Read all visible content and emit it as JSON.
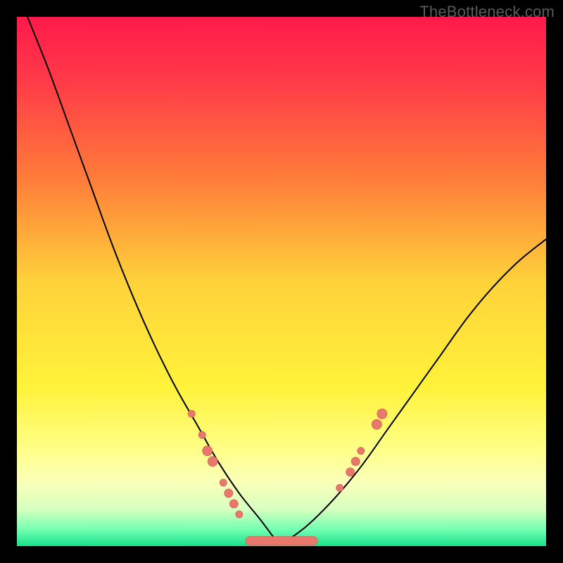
{
  "watermark": "TheBottleneck.com",
  "chart_data": {
    "type": "line",
    "title": "",
    "xlabel": "",
    "ylabel": "",
    "xlim": [
      0,
      100
    ],
    "ylim": [
      0,
      100
    ],
    "background_gradient_stops": [
      {
        "offset": 0.0,
        "color": "#ff1a4b"
      },
      {
        "offset": 0.12,
        "color": "#ff3a48"
      },
      {
        "offset": 0.3,
        "color": "#ff7a3a"
      },
      {
        "offset": 0.5,
        "color": "#ffd23a"
      },
      {
        "offset": 0.7,
        "color": "#fff23a"
      },
      {
        "offset": 0.82,
        "color": "#ffff8a"
      },
      {
        "offset": 0.88,
        "color": "#f9ffb8"
      },
      {
        "offset": 0.93,
        "color": "#d8ffc0"
      },
      {
        "offset": 0.97,
        "color": "#6fffb0"
      },
      {
        "offset": 1.0,
        "color": "#16e08a"
      }
    ],
    "series": [
      {
        "name": "left-curve",
        "x": [
          2,
          6,
          10,
          14,
          18,
          22,
          26,
          30,
          34,
          38,
          42,
          46,
          49
        ],
        "y": [
          100,
          90,
          79,
          68,
          57,
          47,
          38,
          30,
          23,
          16,
          10,
          5,
          1
        ]
      },
      {
        "name": "valley-floor",
        "x": [
          44,
          56
        ],
        "y": [
          1,
          1
        ]
      },
      {
        "name": "right-curve",
        "x": [
          51,
          55,
          60,
          65,
          70,
          75,
          80,
          85,
          90,
          95,
          100
        ],
        "y": [
          1,
          4,
          9,
          15,
          22,
          29,
          36,
          43,
          49,
          54,
          58
        ]
      }
    ],
    "markers": [
      {
        "x": 33,
        "y": 25,
        "r": 5
      },
      {
        "x": 35,
        "y": 21,
        "r": 5
      },
      {
        "x": 36,
        "y": 18,
        "r": 7
      },
      {
        "x": 37,
        "y": 16,
        "r": 7
      },
      {
        "x": 39,
        "y": 12,
        "r": 5
      },
      {
        "x": 40,
        "y": 10,
        "r": 6
      },
      {
        "x": 41,
        "y": 8,
        "r": 6
      },
      {
        "x": 42,
        "y": 6,
        "r": 5
      },
      {
        "x": 61,
        "y": 11,
        "r": 5
      },
      {
        "x": 63,
        "y": 14,
        "r": 6
      },
      {
        "x": 64,
        "y": 16,
        "r": 6
      },
      {
        "x": 65,
        "y": 18,
        "r": 5
      },
      {
        "x": 68,
        "y": 23,
        "r": 7
      },
      {
        "x": 69,
        "y": 25,
        "r": 7
      }
    ],
    "valley_capsule": {
      "x0": 44,
      "x1": 56,
      "y": 1,
      "r": 6
    }
  }
}
